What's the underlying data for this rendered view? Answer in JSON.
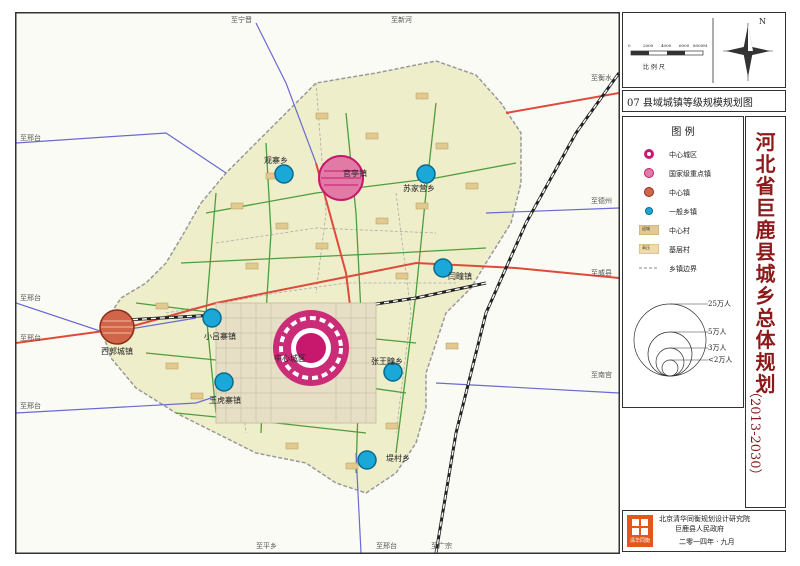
{
  "map": {
    "edge_labels": {
      "top1": "至宁晋",
      "top2": "至新河",
      "left1": "至邢台",
      "left2": "至邢台",
      "left3": "至邢台",
      "right1": "至衡水",
      "right2": "至德州",
      "right3": "至威县",
      "right4": "至南宫",
      "bottom1": "至平乡",
      "bottom2": "至邢台",
      "bottom3": "至广宗",
      "left4": "至邢台"
    },
    "town_labels": {
      "guanzhai": "观寨乡",
      "wangting": "官亭镇",
      "sujiaying": "苏家营乡",
      "yanzhuang": "闫疃镇",
      "xiguocheng": "西郭城镇",
      "xiaolvzhai": "小吕寨镇",
      "center": "中心城区",
      "zhangwangtuan": "张王疃乡",
      "wanghuzhai": "王虎寨镇",
      "tangcun": "堤村乡"
    },
    "colors": {
      "county_fill": "#efeecb",
      "center_city": "#c8186e",
      "key_town": "#e27aa6",
      "center_town": "#d0654a",
      "township": "#1aa8d8",
      "railway": "#222222",
      "highway": "#e04a3a",
      "road_green": "#4e9d3e",
      "road_blue": "#6a6ad0"
    }
  },
  "side": {
    "scale_label": "比  例  尺",
    "scale_ticks": [
      "0",
      "2000",
      "4000",
      "6000",
      "8000M"
    ],
    "compass": "N",
    "sheet_title": "07 县域城镇等级规模规划图",
    "legend_title": "图  例",
    "legend": [
      {
        "icon": "center-city",
        "label": "中心城区"
      },
      {
        "icon": "key-town",
        "label": "国家级重点镇"
      },
      {
        "icon": "center-town",
        "label": "中心镇"
      },
      {
        "icon": "township",
        "label": "一般乡镇"
      },
      {
        "icon": "center-village",
        "label": "中心村",
        "tag": "迎城"
      },
      {
        "icon": "base-village",
        "label": "基层村",
        "tag": "高压"
      },
      {
        "icon": "township-border",
        "label": "乡镇边界"
      }
    ],
    "bubble_labels": [
      "25万人",
      "5万人",
      "3万人",
      "<2万人"
    ],
    "vertical_title": [
      "河",
      "北",
      "省",
      "巨",
      "鹿",
      "县",
      "城",
      "乡",
      "总",
      "体",
      "规",
      "划"
    ],
    "period": "（2013-2030）",
    "institute1": "北京清华同衡规划设计研究院",
    "institute2": "巨鹿县人民政府",
    "logo_text": "清华同衡",
    "date": "二零一四年 · 九月"
  }
}
